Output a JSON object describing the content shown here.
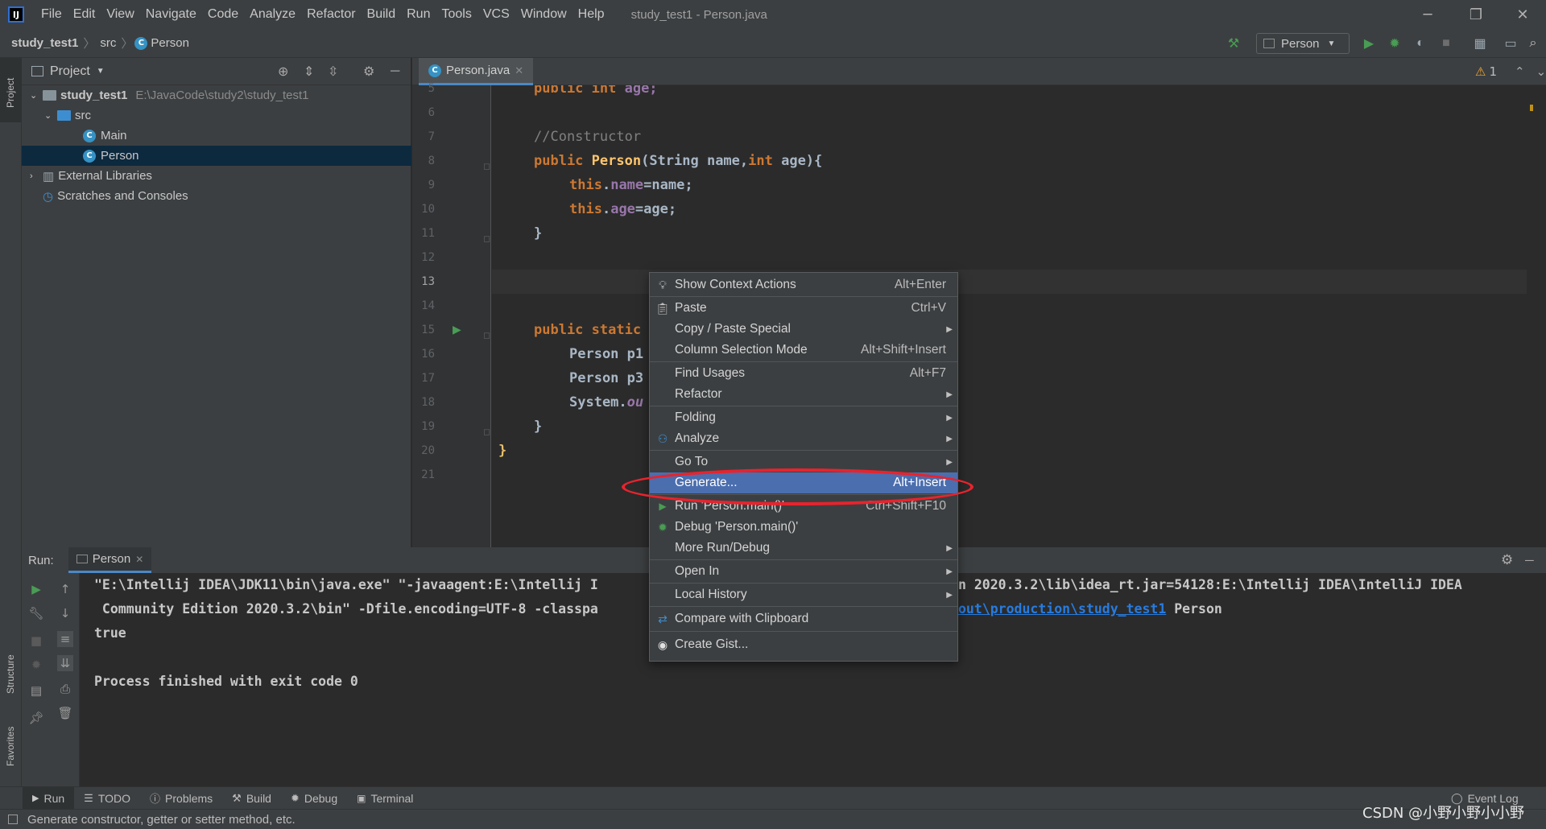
{
  "menubar": {
    "items": [
      "File",
      "Edit",
      "View",
      "Navigate",
      "Code",
      "Analyze",
      "Refactor",
      "Build",
      "Run",
      "Tools",
      "VCS",
      "Window",
      "Help"
    ],
    "window_title": "study_test1 - Person.java"
  },
  "navbar": {
    "breadcrumbs": [
      "study_test1",
      "src",
      "Person"
    ],
    "run_config": "Person"
  },
  "left_stripe": {
    "project": "Project",
    "structure": "Structure",
    "favorites": "Favorites"
  },
  "project_panel": {
    "title": "Project",
    "tree": [
      {
        "label": "study_test1",
        "path": "E:\\JavaCode\\study2\\study_test1"
      },
      {
        "label": "src"
      },
      {
        "label": "Main"
      },
      {
        "label": "Person"
      },
      {
        "label": "External Libraries"
      },
      {
        "label": "Scratches and Consoles"
      }
    ]
  },
  "editor": {
    "tab": "Person.java",
    "warning_count": "1",
    "line_numbers": [
      "5",
      "6",
      "7",
      "8",
      "9",
      "10",
      "11",
      "12",
      "13",
      "14",
      "15",
      "16",
      "17",
      "18",
      "19",
      "20",
      "21"
    ],
    "code": {
      "l5_kw": "public int ",
      "l5_rest": "age;",
      "l7": "//Constructor",
      "l8_kw": "public ",
      "l8_fn": "Person",
      "l8_a": "(String name,",
      "l8_kw2": "int ",
      "l8_b": "age){",
      "l9_kw": "this",
      "l9_dot": ".",
      "l9_fld": "name",
      "l9_rest": "=name;",
      "l10_kw": "this",
      "l10_dot": ".",
      "l10_fld": "age",
      "l10_rest": "=age;",
      "l11": "}",
      "l15_kw": "public static",
      "l16": "Person p1",
      "l17": "Person p3",
      "l18_a": "System.",
      "l18_it": "ou",
      "l19": "}",
      "l20": "}"
    }
  },
  "run_panel": {
    "label": "Run:",
    "tab": "Person",
    "console": {
      "line1_a": "\"E:\\Intellij IDEA\\JDK11\\bin\\java.exe\" \"-javaagent:E:\\Intellij I",
      "line1_b": "n 2020.3.2\\lib\\idea_rt.jar=54128:E:\\Intellij IDEA\\IntelliJ IDEA",
      "line2_a": " Community Edition 2020.3.2\\bin\" -Dfile.encoding=UTF-8 -classpa",
      "line2_link": "out\\production\\study_test1",
      "line2_c": " Person",
      "line3": "true",
      "line5": "Process finished with exit code 0"
    }
  },
  "bottom_tools": [
    "Run",
    "TODO",
    "Problems",
    "Build",
    "Debug",
    "Terminal"
  ],
  "event_log": "Event Log",
  "status_bar": {
    "text": "Generate constructor, getter or setter method, etc."
  },
  "watermark": "CSDN @小野小野小小野",
  "context_menu": {
    "items": [
      {
        "label": "Show Context Actions",
        "shortcut": "Alt+Enter",
        "icon": "lightbulb-icon"
      },
      {
        "label": "Paste",
        "shortcut": "Ctrl+V",
        "icon": "clipboard-icon"
      },
      {
        "label": "Copy / Paste Special",
        "submenu": true
      },
      {
        "label": "Column Selection Mode",
        "shortcut": "Alt+Shift+Insert"
      },
      {
        "label": "Find Usages",
        "shortcut": "Alt+F7"
      },
      {
        "label": "Refactor",
        "submenu": true
      },
      {
        "label": "Folding",
        "submenu": true
      },
      {
        "label": "Analyze",
        "submenu": true,
        "icon": "analyze-icon"
      },
      {
        "label": "Go To",
        "submenu": true
      },
      {
        "label": "Generate...",
        "shortcut": "Alt+Insert",
        "highlighted": true
      },
      {
        "label": "Run 'Person.main()'",
        "shortcut": "Ctrl+Shift+F10",
        "icon": "run-icon"
      },
      {
        "label": "Debug 'Person.main()'",
        "icon": "debug-icon"
      },
      {
        "label": "More Run/Debug",
        "submenu": true
      },
      {
        "label": "Open In",
        "submenu": true
      },
      {
        "label": "Local History",
        "submenu": true
      },
      {
        "label": "Compare with Clipboard",
        "icon": "compare-icon"
      },
      {
        "label": "Create Gist...",
        "icon": "github-icon"
      }
    ]
  },
  "colors": {
    "accent": "#4b6eaf",
    "annotation": "#e8232d",
    "run_green": "#499c54"
  }
}
